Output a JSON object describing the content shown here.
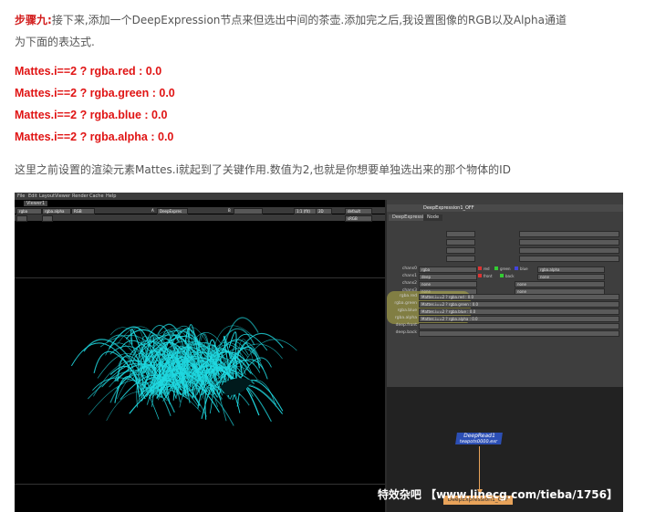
{
  "article": {
    "step_label": "步骤九:",
    "intro_line1": "接下来,添加一个DeepExpression节点来但选出中间的茶壶.添加完之后,我设置图像的RGB以及Alpha通道",
    "intro_line2": "为下面的表达式.",
    "expressions": [
      "Mattes.i==2 ? rgba.red : 0.0",
      "Mattes.i==2 ? rgba.green : 0.0",
      "Mattes.i==2 ? rgba.blue : 0.0",
      "Mattes.i==2 ? rgba.alpha : 0.0"
    ],
    "outro": "这里之前设置的渲染元素Mattes.i就起到了关键作用.数值为2,也就是你想要单独选出来的那个物体的ID"
  },
  "nuke": {
    "menu": [
      "File",
      "Edit",
      "Layout",
      "Viewer",
      "Render",
      "Cache",
      "Help"
    ],
    "viewer_tab": "Viewer1",
    "viewer_controls": {
      "channels": "rgba",
      "alpha": "rgba.alpha",
      "colorspace": "RGB",
      "input_a": "A",
      "node_a": "DeepExpres",
      "input_b": "B",
      "zoom": "1:1 (fit)",
      "view": "2D",
      "lut": "default",
      "lut2": "sRGB"
    },
    "properties": {
      "panel_title": "DeepExpression1_OFF",
      "tabs": [
        "DeepExpression",
        "Node"
      ],
      "chans": [
        {
          "label": "chans0",
          "value": "rgba",
          "checks": [
            "red",
            "green",
            "blue"
          ],
          "extra": "rgba.alpha"
        },
        {
          "label": "chans1",
          "value": "deep",
          "checks": [
            "front",
            "back"
          ],
          "extra": "none"
        },
        {
          "label": "chans2",
          "value": "none",
          "checks": [],
          "extra": "none"
        },
        {
          "label": "chans3",
          "value": "none",
          "checks": [],
          "extra": "none"
        }
      ],
      "expr_rows": [
        {
          "label": "rgba.red",
          "value": "Mattes.i==2 ? rgba.red : 0.0"
        },
        {
          "label": "rgba.green",
          "value": "Mattes.i==2 ? rgba.green : 0.0"
        },
        {
          "label": "rgba.blue",
          "value": "Mattes.i==2 ? rgba.blue : 0.0"
        },
        {
          "label": "rgba.alpha",
          "value": "Mattes.i==2 ? rgba.alpha : 0.0"
        },
        {
          "label": "deep.front",
          "value": ""
        },
        {
          "label": "deep.back",
          "value": ""
        }
      ]
    },
    "dag": {
      "read_node_name": "DeepRead1",
      "read_node_file": "teapots0000.exr",
      "expr_node_name": "DeepExpression1_OFF"
    },
    "colors": {
      "read_node": "#2c4fb5",
      "expr_node": "#e8a35a",
      "hair": "#1fd8e0"
    }
  },
  "watermark": "特效杂吧 【www.linecg.com/tieba/1756】"
}
